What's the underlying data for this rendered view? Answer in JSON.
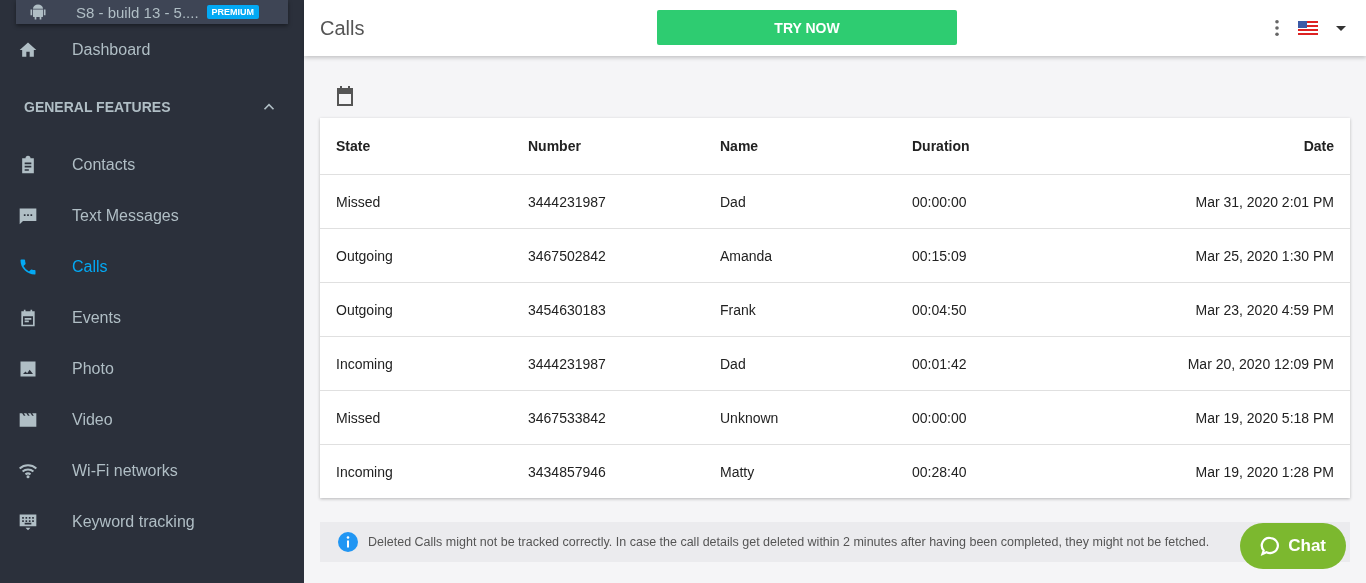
{
  "device": {
    "title": "S8 - build 13 - 5....",
    "badge": "PREMIUM"
  },
  "sidebar": {
    "top_items": [
      {
        "label": "Dashboard",
        "selected": false
      }
    ],
    "section": {
      "title": "GENERAL FEATURES",
      "expanded": true
    },
    "items": [
      {
        "label": "Contacts",
        "selected": false
      },
      {
        "label": "Text Messages",
        "selected": false
      },
      {
        "label": "Calls",
        "selected": true
      },
      {
        "label": "Events",
        "selected": false
      },
      {
        "label": "Photo",
        "selected": false
      },
      {
        "label": "Video",
        "selected": false
      },
      {
        "label": "Wi-Fi networks",
        "selected": false
      },
      {
        "label": "Keyword tracking",
        "selected": false
      }
    ]
  },
  "header": {
    "title": "Calls",
    "cta": "TRY NOW"
  },
  "table": {
    "columns": [
      "State",
      "Number",
      "Name",
      "Duration",
      "Date"
    ],
    "rows": [
      [
        "Missed",
        "3444231987",
        "Dad",
        "00:00:00",
        "Mar 31, 2020 2:01 PM"
      ],
      [
        "Outgoing",
        "3467502842",
        "Amanda",
        "00:15:09",
        "Mar 25, 2020 1:30 PM"
      ],
      [
        "Outgoing",
        "3454630183",
        "Frank",
        "00:04:50",
        "Mar 23, 2020 4:59 PM"
      ],
      [
        "Incoming",
        "3444231987",
        "Dad",
        "00:01:42",
        "Mar 20, 2020 12:09 PM"
      ],
      [
        "Missed",
        "3467533842",
        "Unknown",
        "00:00:00",
        "Mar 19, 2020 5:18 PM"
      ],
      [
        "Incoming",
        "3434857946",
        "Matty",
        "00:28:40",
        "Mar 19, 2020 1:28 PM"
      ]
    ]
  },
  "notice": "Deleted Calls might not be tracked correctly. In case the call details get deleted within 2 minutes after having been completed, they might not be fetched.",
  "chat": "Chat"
}
